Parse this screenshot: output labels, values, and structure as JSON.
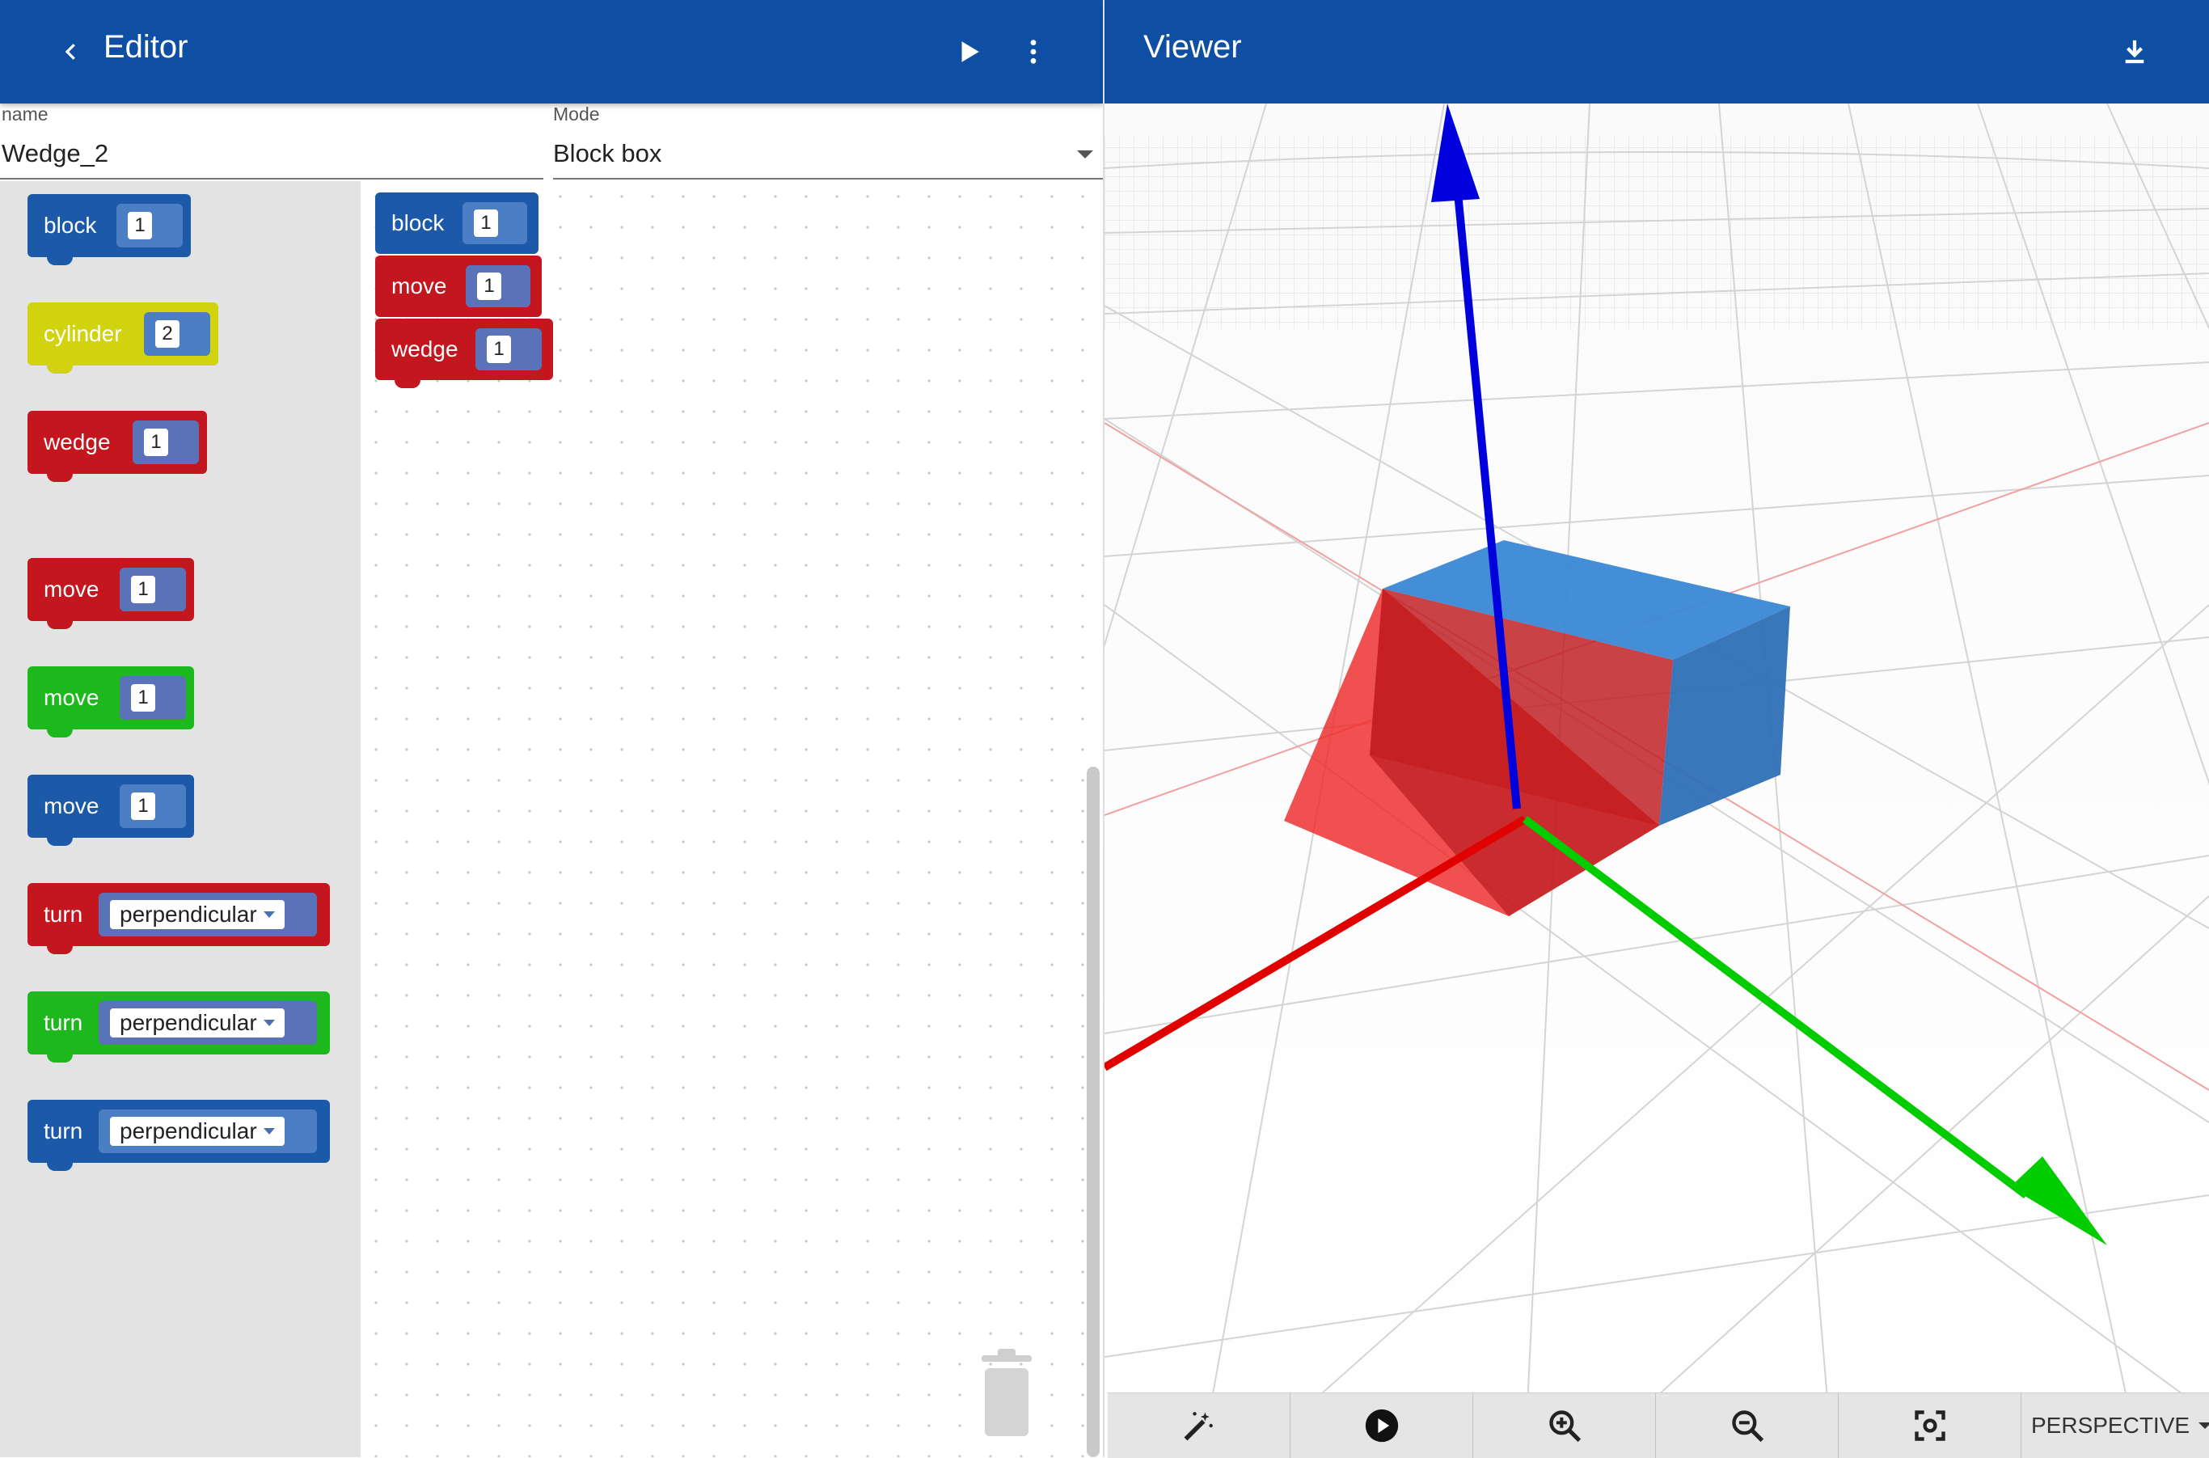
{
  "editor": {
    "title": "Editor",
    "back_icon": "chevron-left-icon",
    "run_icon": "play-icon",
    "menu_icon": "more-vert-icon"
  },
  "fields": {
    "name_label": "name",
    "name_value": "Wedge_2",
    "mode_label": "Mode",
    "mode_value": "Block box"
  },
  "toolbox": [
    {
      "label": "block",
      "value": "1",
      "color": "#1c5aa9"
    },
    {
      "label": "cylinder",
      "value": "2",
      "color": "#d1d30f"
    },
    {
      "label": "wedge",
      "value": "1",
      "color": "#c3161f"
    },
    {
      "label": "move",
      "value": "1",
      "color": "#c3161f"
    },
    {
      "label": "move",
      "value": "1",
      "color": "#1db81d"
    },
    {
      "label": "move",
      "value": "1",
      "color": "#1c5aa9"
    },
    {
      "label": "turn",
      "value": "perpendicular",
      "color": "#c3161f"
    },
    {
      "label": "turn",
      "value": "perpendicular",
      "color": "#1db81d"
    },
    {
      "label": "turn",
      "value": "perpendicular",
      "color": "#1c5aa9"
    }
  ],
  "workspace": [
    {
      "label": "block",
      "value": "1",
      "color": "#1c5aa9"
    },
    {
      "label": "move",
      "value": "1",
      "color": "#c3161f"
    },
    {
      "label": "wedge",
      "value": "1",
      "color": "#c3161f"
    }
  ],
  "viewer": {
    "title": "Viewer",
    "download_icon": "download-icon",
    "axis_colors": {
      "x": "#e00000",
      "y": "#00cc00",
      "z": "#0000dd"
    },
    "box_color": "#3d8bd9",
    "wedge_color": "#ee2222"
  },
  "viewer_toolbar": {
    "tools": [
      "magic-wand-icon",
      "play-circle-icon",
      "zoom-in-icon",
      "zoom-out-icon",
      "focus-icon"
    ],
    "mode": "PERSPECTIVE"
  }
}
